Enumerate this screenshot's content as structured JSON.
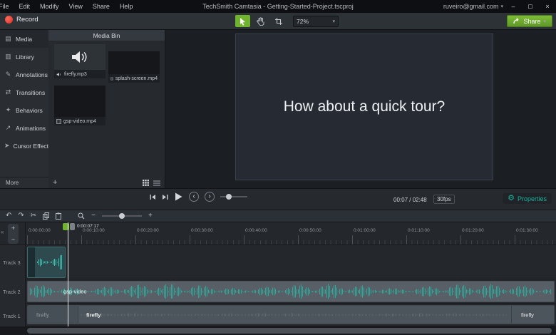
{
  "colors": {
    "accent_green": "#6fb32f",
    "teal": "#19b09b",
    "record_red": "#d92c21"
  },
  "titlebar": {
    "menu_items": [
      "File",
      "Edit",
      "Modify",
      "View",
      "Share",
      "Help"
    ],
    "title": "TechSmith Camtasia - Getting-Started-Project.tscproj",
    "account": "ruveiro@gmail.com",
    "minimize": "–",
    "maximize": "□",
    "close": "×"
  },
  "toolbar": {
    "record_label": "Record",
    "zoom_value": "72%",
    "share_label": "Share"
  },
  "sidebar": {
    "items": [
      {
        "label": "Media",
        "icon": "media-icon"
      },
      {
        "label": "Library",
        "icon": "library-icon"
      },
      {
        "label": "Annotations",
        "icon": "annotations-icon"
      },
      {
        "label": "Transitions",
        "icon": "transitions-icon"
      },
      {
        "label": "Behaviors",
        "icon": "behaviors-icon"
      },
      {
        "label": "Animations",
        "icon": "animations-icon"
      },
      {
        "label": "Cursor Effects",
        "icon": "cursor-effects-icon"
      }
    ],
    "more_label": "More"
  },
  "media_bin": {
    "title": "Media Bin",
    "add_label": "+",
    "items": [
      {
        "name": "firefly.mp3",
        "type": "audio"
      },
      {
        "name": "splash-screen.mp4",
        "type": "video"
      },
      {
        "name": "gsp-video.mp4",
        "type": "video"
      }
    ]
  },
  "canvas": {
    "slide_text": "How about a quick tour?"
  },
  "playback": {
    "time": "00:07 / 02:48",
    "fps": "30fps",
    "properties_label": "Properties"
  },
  "timeline": {
    "playhead_time": "0:00:07:17",
    "ruler_labels": [
      "0:00:00:00",
      "0:00:10:00",
      "0:00:20:00",
      "0:00:30:00",
      "0:00:40:00",
      "0:00:50:00",
      "0:01:00:00",
      "0:01:10:00",
      "0:01:20:00",
      "0:01:30:00"
    ],
    "tracks": [
      {
        "name": "Track 3"
      },
      {
        "name": "Track 2"
      },
      {
        "name": "Track 1"
      }
    ],
    "clip_gsp_label": "gsp-video",
    "clip_firefly_dim_label": "firefly",
    "clip_firefly_label": "firefly",
    "clip_firefly_end_label": "firefly"
  }
}
